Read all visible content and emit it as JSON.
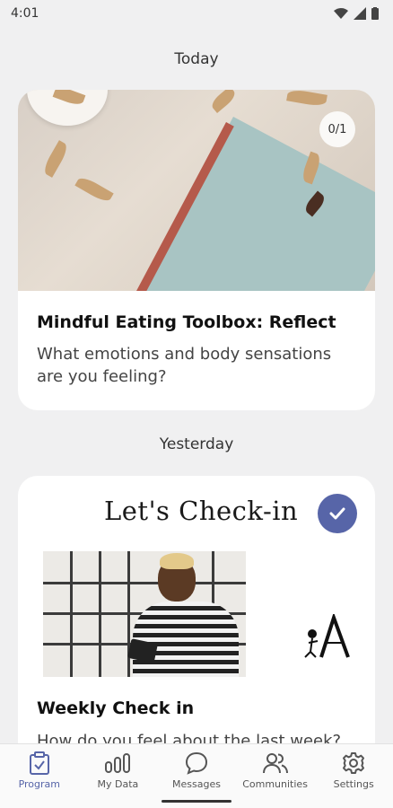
{
  "status_bar": {
    "time": "4:01"
  },
  "sections": {
    "today": "Today",
    "yesterday": "Yesterday"
  },
  "card_reflect": {
    "progress": "0/1",
    "title": "Mindful Eating Toolbox: Reflect",
    "subtitle": "What emotions and body sensations are you feeling?"
  },
  "card_checkin": {
    "banner_title": "Let's Check-in",
    "title": "Weekly Check in",
    "subtitle": "How do you feel about the last week?",
    "completed": true
  },
  "nav": {
    "items": [
      {
        "label": "Program",
        "icon": "clipboard-check-icon",
        "active": true
      },
      {
        "label": "My Data",
        "icon": "bar-chart-icon",
        "active": false
      },
      {
        "label": "Messages",
        "icon": "chat-bubble-icon",
        "active": false
      },
      {
        "label": "Communities",
        "icon": "people-icon",
        "active": false
      },
      {
        "label": "Settings",
        "icon": "gear-icon",
        "active": false
      }
    ]
  },
  "colors": {
    "accent": "#5765a8",
    "background": "#f0f0f1"
  }
}
